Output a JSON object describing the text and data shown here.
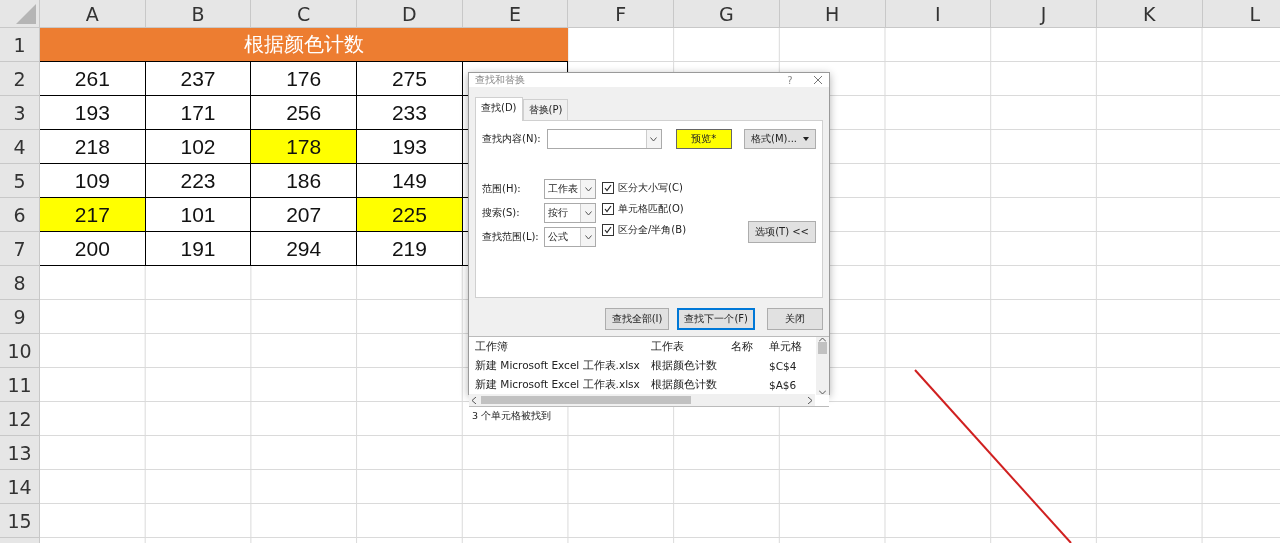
{
  "sheet": {
    "columns": [
      "A",
      "B",
      "C",
      "D",
      "E",
      "F",
      "G",
      "H",
      "I",
      "J",
      "K",
      "L"
    ],
    "row_numbers": [
      "1",
      "2",
      "3",
      "4",
      "5",
      "6",
      "7",
      "8",
      "9",
      "10",
      "11",
      "12",
      "13",
      "14",
      "15"
    ],
    "title": "根据颜色计数",
    "rows": [
      [
        {
          "value": "261",
          "highlighted": false
        },
        {
          "value": "237",
          "highlighted": false
        },
        {
          "value": "176",
          "highlighted": false
        },
        {
          "value": "275",
          "highlighted": false
        }
      ],
      [
        {
          "value": "193",
          "highlighted": false
        },
        {
          "value": "171",
          "highlighted": false
        },
        {
          "value": "256",
          "highlighted": false
        },
        {
          "value": "233",
          "highlighted": false
        }
      ],
      [
        {
          "value": "218",
          "highlighted": false
        },
        {
          "value": "102",
          "highlighted": false
        },
        {
          "value": "178",
          "highlighted": true
        },
        {
          "value": "193",
          "highlighted": false
        }
      ],
      [
        {
          "value": "109",
          "highlighted": false
        },
        {
          "value": "223",
          "highlighted": false
        },
        {
          "value": "186",
          "highlighted": false
        },
        {
          "value": "149",
          "highlighted": false
        }
      ],
      [
        {
          "value": "217",
          "highlighted": true
        },
        {
          "value": "101",
          "highlighted": false
        },
        {
          "value": "207",
          "highlighted": false
        },
        {
          "value": "225",
          "highlighted": true
        }
      ],
      [
        {
          "value": "200",
          "highlighted": false
        },
        {
          "value": "191",
          "highlighted": false
        },
        {
          "value": "294",
          "highlighted": false
        },
        {
          "value": "219",
          "highlighted": false
        }
      ]
    ]
  },
  "dialog": {
    "title": "查找和替换",
    "help": "?",
    "tabs": [
      {
        "label": "查找(D)",
        "selected": true
      },
      {
        "label": "替换(P)",
        "selected": false
      }
    ],
    "find_label": "查找内容(N):",
    "preview": "预览*",
    "format_button": "格式(M)...",
    "selects": [
      {
        "label": "范围(H):",
        "value": "工作表"
      },
      {
        "label": "搜索(S):",
        "value": "按行"
      },
      {
        "label": "查找范围(L):",
        "value": "公式"
      }
    ],
    "checkboxes": [
      {
        "label": "区分大小写(C)",
        "checked": true
      },
      {
        "label": "单元格匹配(O)",
        "checked": true
      },
      {
        "label": "区分全/半角(B)",
        "checked": true
      }
    ],
    "options_button": "选项(T) <<",
    "buttons": [
      {
        "label": "查找全部(I)",
        "selected": false
      },
      {
        "label": "查找下一个(F)",
        "selected": true
      },
      {
        "label": "关闭",
        "selected": false
      }
    ],
    "results": {
      "columns": [
        "工作簿",
        "工作表",
        "名称",
        "单元格"
      ],
      "rows": [
        [
          "新建 Microsoft Excel 工作表.xlsx",
          "根据颜色计数",
          "",
          "$C$4"
        ],
        [
          "新建 Microsoft Excel 工作表.xlsx",
          "根据颜色计数",
          "",
          "$A$6"
        ]
      ]
    },
    "status": "3 个单元格被找到"
  }
}
